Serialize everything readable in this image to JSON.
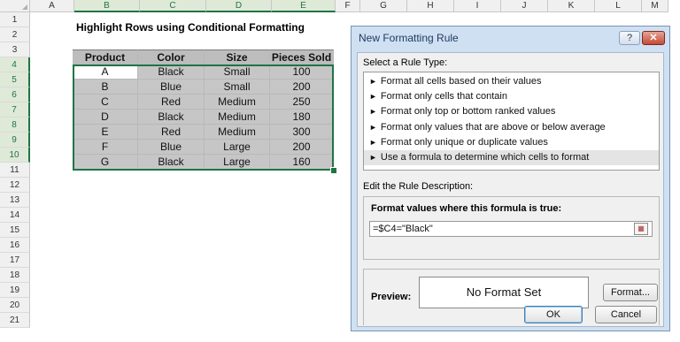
{
  "sheet": {
    "columns": [
      {
        "label": "",
        "w": 14
      },
      {
        "label": "A",
        "w": 50
      },
      {
        "label": "B",
        "w": 74
      },
      {
        "label": "C",
        "w": 75
      },
      {
        "label": "D",
        "w": 74
      },
      {
        "label": "E",
        "w": 72
      },
      {
        "label": "F",
        "w": 28
      },
      {
        "label": "G",
        "w": 53
      },
      {
        "label": "H",
        "w": 53
      },
      {
        "label": "I",
        "w": 53
      },
      {
        "label": "J",
        "w": 53
      },
      {
        "label": "K",
        "w": 53
      },
      {
        "label": "L",
        "w": 53
      },
      {
        "label": "M",
        "w": 30
      }
    ],
    "selected_columns": [
      "B",
      "C",
      "D",
      "E"
    ],
    "rows": [
      "1",
      "2",
      "3",
      "4",
      "5",
      "6",
      "7",
      "8",
      "9",
      "10",
      "11",
      "12",
      "13",
      "14",
      "15",
      "16",
      "17",
      "18",
      "19",
      "20",
      "21"
    ],
    "selected_rows": [
      "4",
      "5",
      "6",
      "7",
      "8",
      "9",
      "10"
    ],
    "title": "Highlight Rows using Conditional Formatting",
    "table": {
      "headers": [
        "Product",
        "Color",
        "Size",
        "Pieces Sold"
      ],
      "rows": [
        [
          "A",
          "Black",
          "Small",
          "100"
        ],
        [
          "B",
          "Blue",
          "Small",
          "200"
        ],
        [
          "C",
          "Red",
          "Medium",
          "250"
        ],
        [
          "D",
          "Black",
          "Medium",
          "180"
        ],
        [
          "E",
          "Red",
          "Medium",
          "300"
        ],
        [
          "F",
          "Blue",
          "Large",
          "200"
        ],
        [
          "G",
          "Black",
          "Large",
          "160"
        ]
      ]
    }
  },
  "dialog": {
    "title": "New Formatting Rule",
    "help_label": "?",
    "close_label": "✕",
    "select_rule_type_label": "Select a Rule Type:",
    "rule_types": [
      "Format all cells based on their values",
      "Format only cells that contain",
      "Format only top or bottom ranked values",
      "Format only values that are above or below average",
      "Format only unique or duplicate values",
      "Use a formula to determine which cells to format"
    ],
    "selected_rule_index": 5,
    "edit_description_label": "Edit the Rule Description:",
    "formula_label": "Format values where this formula is true:",
    "formula_value": "=$C4=\"Black\"",
    "preview_label": "Preview:",
    "preview_text": "No Format Set",
    "format_button": "Format...",
    "ok_button": "OK",
    "cancel_button": "Cancel"
  },
  "colors": {
    "selection": "#217346",
    "highlight_fill": "#c6c6c6",
    "dialog_frame": "#cfe0f3",
    "dialog_body": "#f0f0f0"
  }
}
